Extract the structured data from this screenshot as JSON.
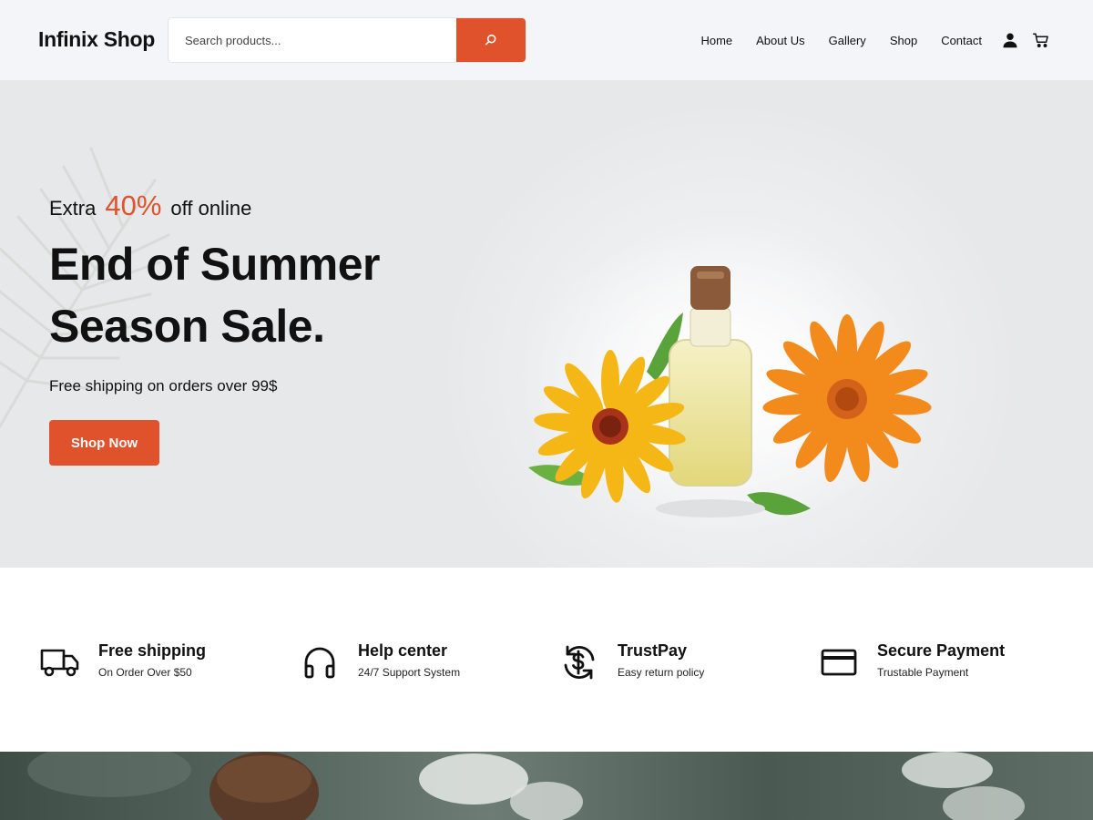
{
  "header": {
    "logo": "Infinix Shop",
    "search": {
      "placeholder": "Search products...",
      "button_icon": "search-icon"
    },
    "nav": [
      {
        "label": "Home"
      },
      {
        "label": "About Us"
      },
      {
        "label": "Gallery"
      },
      {
        "label": "Shop"
      },
      {
        "label": "Contact"
      }
    ],
    "icons": [
      "user-icon",
      "cart-icon"
    ]
  },
  "hero": {
    "promo_prefix": "Extra",
    "promo_percent": "40%",
    "promo_suffix": "off online",
    "title": "End of Summer Season Sale.",
    "subtitle": "Free shipping on orders over 99$",
    "cta_label": "Shop Now"
  },
  "features": [
    {
      "icon": "truck-icon",
      "title": "Free shipping",
      "subtitle": "On Order Over $50"
    },
    {
      "icon": "headphones-icon",
      "title": "Help center",
      "subtitle": "24/7 Support System"
    },
    {
      "icon": "dollar-refresh-icon",
      "title": "TrustPay",
      "subtitle": "Easy return policy"
    },
    {
      "icon": "credit-card-icon",
      "title": "Secure Payment",
      "subtitle": "Trustable Payment"
    }
  ],
  "colors": {
    "accent": "#e0522b",
    "header_bg": "#f4f5f9",
    "hero_bg": "#e8e9eb"
  }
}
